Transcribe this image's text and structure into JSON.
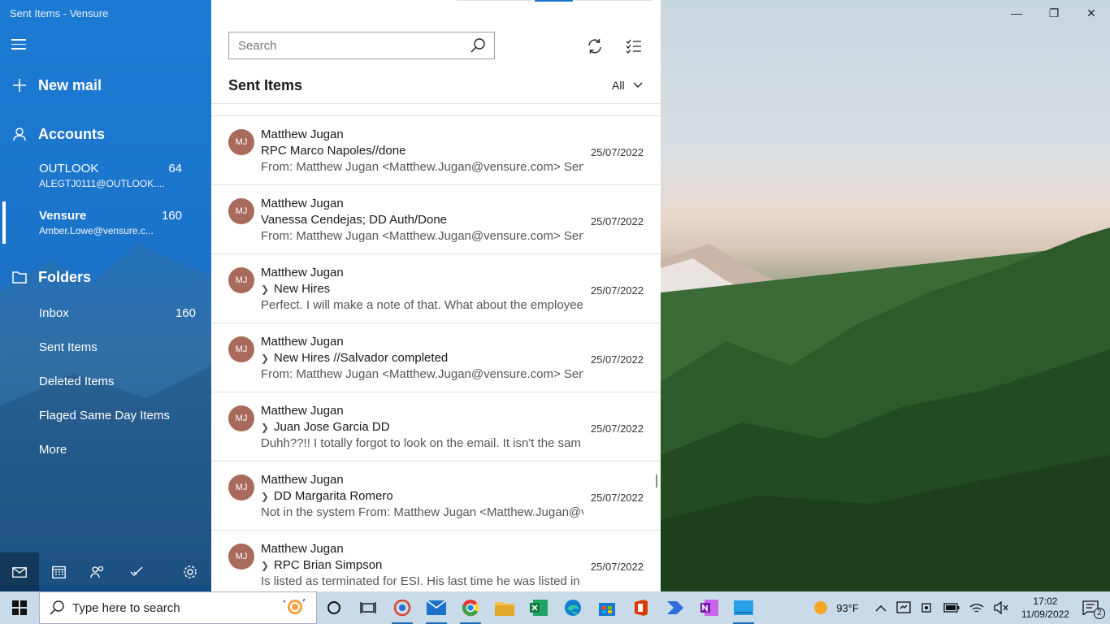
{
  "window": {
    "title": "Sent Items - Vensure",
    "minimize": "—",
    "restore": "❐",
    "close": "✕"
  },
  "nav": {
    "new_mail": "New mail",
    "accounts_label": "Accounts",
    "accounts": [
      {
        "name": "OUTLOOK",
        "email": "ALEGTJ0111@OUTLOOK....",
        "count": "64"
      },
      {
        "name": "Vensure",
        "email": "Amber.Lowe@vensure.c...",
        "count": "160"
      }
    ],
    "folders_label": "Folders",
    "folders": [
      {
        "name": "Inbox",
        "count": "160"
      },
      {
        "name": "Sent Items",
        "count": ""
      },
      {
        "name": "Deleted Items",
        "count": ""
      },
      {
        "name": "Flaged Same Day Items",
        "count": ""
      },
      {
        "name": "More",
        "count": ""
      }
    ]
  },
  "list": {
    "search_placeholder": "Search",
    "title": "Sent Items",
    "filter": "All",
    "messages": [
      {
        "initials": "MJ",
        "sender": "Matthew Jugan",
        "subject": "RPC Marco Napoles//done",
        "thread": false,
        "date": "25/07/2022",
        "preview": "From: Matthew Jugan <Matthew.Jugan@vensure.com> Sent"
      },
      {
        "initials": "MJ",
        "sender": "Matthew Jugan",
        "subject": "Vanessa Cendejas; DD Auth/Done",
        "thread": false,
        "date": "25/07/2022",
        "preview": "From: Matthew Jugan <Matthew.Jugan@vensure.com> Sent"
      },
      {
        "initials": "MJ",
        "sender": "Matthew Jugan",
        "subject": "New Hires",
        "thread": true,
        "date": "25/07/2022",
        "preview": "Perfect. I will make a note of that. What about the employee"
      },
      {
        "initials": "MJ",
        "sender": "Matthew Jugan",
        "subject": "New Hires //Salvador completed",
        "thread": true,
        "date": "25/07/2022",
        "preview": "From: Matthew Jugan <Matthew.Jugan@vensure.com> Sent"
      },
      {
        "initials": "MJ",
        "sender": "Matthew Jugan",
        "subject": "Juan Jose Garcia DD",
        "thread": true,
        "date": "25/07/2022",
        "preview": "Duhh??!! I totally forgot to look on the email. It isn't the sam"
      },
      {
        "initials": "MJ",
        "sender": "Matthew Jugan",
        "subject": "DD Margarita Romero",
        "thread": true,
        "date": "25/07/2022",
        "preview": "Not in the system From: Matthew Jugan <Matthew.Jugan@v"
      },
      {
        "initials": "MJ",
        "sender": "Matthew Jugan",
        "subject": "RPC Brian Simpson",
        "thread": true,
        "date": "25/07/2022",
        "preview": "Is listed as terminated for ESI. His last time he was listed in th"
      }
    ]
  },
  "taskbar": {
    "search_placeholder": "Type here to search",
    "weather": "93°F",
    "time": "17:02",
    "date": "11/09/2022",
    "notifications": "2"
  },
  "colors": {
    "nav_blue": "#1a73c9",
    "avatar": "#a86a5a",
    "taskbar": "#c9dbe9"
  }
}
